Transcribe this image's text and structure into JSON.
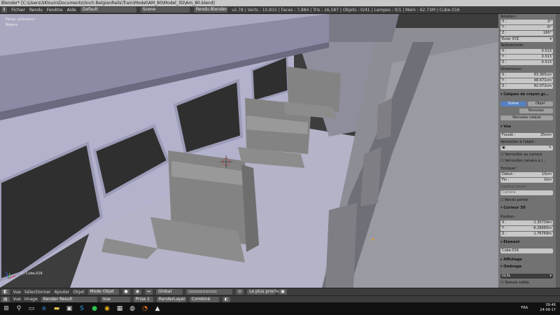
{
  "titlebar": {
    "text": "Blender* [C:\\Users\\SKlouin\\Documents\\Snch BelgianRails\\Train\\Model\\AM_80\\Model_3D\\Am_80.blend]"
  },
  "header": {
    "menus": [
      "Fichier",
      "Rendu",
      "Fenêtre",
      "Aide"
    ],
    "layout": "Default",
    "scene": "Scene",
    "engine": "Rendu Blender",
    "stats": "v2.78 | Verts : 10,815 | Faces : 7,884 | Tris : 16,587 | Objets : 0/41 | Lampes : 0/1 | Mem : 62.73M | Cube.016"
  },
  "viewport": {
    "view_name": "Persp. utilisateur",
    "units": "Meters",
    "object_info": "(1) Cube.016"
  },
  "panel": {
    "rotation_label": "Rotation :",
    "rotation": [
      {
        "axis": "X :",
        "value": "0°"
      },
      {
        "axis": "Y :",
        "value": "-0°"
      },
      {
        "axis": "Z :",
        "value": "180°"
      }
    ],
    "rot_mode": "Euler XYZ",
    "scale_label": "Taille/échelle :",
    "scale": [
      {
        "axis": "X :",
        "value": "0.513"
      },
      {
        "axis": "Y :",
        "value": "0.513"
      },
      {
        "axis": "Z :",
        "value": "0.513"
      }
    ],
    "dims_label": "Dimensions :",
    "dims": [
      {
        "axis": "X :",
        "value": "83.365cm"
      },
      {
        "axis": "Y :",
        "value": "48.671cm"
      },
      {
        "axis": "Z :",
        "value": "82.072cm"
      }
    ],
    "gp_title": "Calques de crayon gr...",
    "gp_scene": "Scène",
    "gp_object": "Objet",
    "gp_new": "Nouveau",
    "gp_new_layer": "Nouveau calque",
    "view_title": "Vue",
    "focal_label": "Focale :",
    "focal_value": "35mm",
    "lock_label": "Verrouiller à l'objet :",
    "lock_cursor": "Verrouiller au curseur",
    "lock_camera": "Verrouiller caméra à l...",
    "clip_label": "Tronquer :",
    "clip_start_label": "Début :",
    "clip_start": "10cm",
    "clip_end_label": "Fin :",
    "clip_end": "1km",
    "local_camera": "Caméra locale :",
    "camera": "Caméra",
    "render_border": "Rendu partiel",
    "cursor_title": "Curseur 3D",
    "position_label": "Position :",
    "cursor": [
      {
        "axis": "X :",
        "value": "-1.30734m"
      },
      {
        "axis": "Y :",
        "value": "-6.28665m"
      },
      {
        "axis": "Z :",
        "value": "1.76769m"
      }
    ],
    "item_title": "Élément",
    "item_name": "Cube.016",
    "display": "Affichage",
    "shading": "Ombrage",
    "shading_mode": "GLSL",
    "texture_solid": "Texture solide"
  },
  "bottom_header": {
    "menus": [
      "Vue",
      "Sélectionner",
      "Ajouter",
      "Objet"
    ],
    "mode": "Mode Objet",
    "pivot": "Global",
    "snap": "Le plus proche"
  },
  "image_header": {
    "menus": [
      "Vue",
      "Image"
    ],
    "image": "Render Result",
    "view": "Vue",
    "slot": "Prise 1",
    "layer": "RenderLayer",
    "pass": "Combiné"
  },
  "taskbar": {
    "lang": "FRA",
    "time": "09:46",
    "date": "24-09-17"
  }
}
